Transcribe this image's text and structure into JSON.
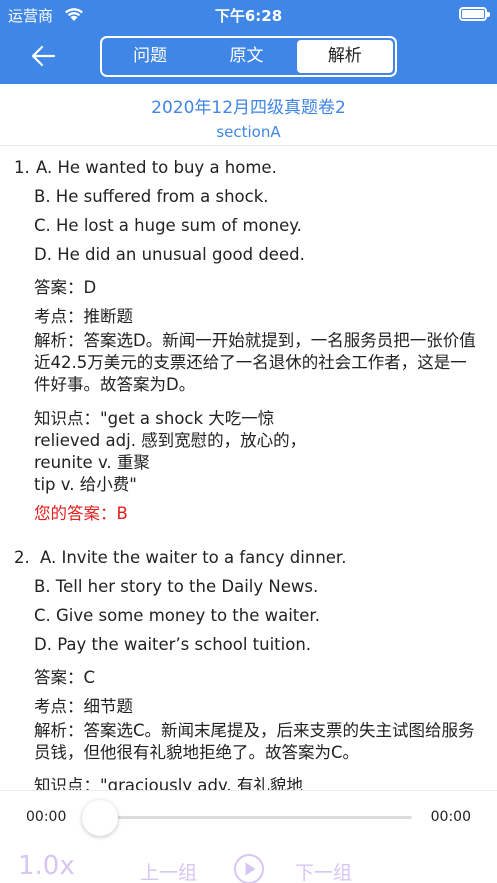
{
  "status_bar": {
    "carrier": "运营商",
    "time": "下午6:28"
  },
  "header": {
    "tabs": [
      "问题",
      "原文",
      "解析"
    ],
    "active_tab": "解析"
  },
  "title_block": {
    "title": "2020年12月四级真题卷2",
    "section": "sectionA"
  },
  "questions": [
    {
      "number": "1.",
      "options": [
        "A. He wanted to buy a home.",
        "B. He suffered from a shock.",
        "C. He lost a huge sum of money.",
        "D. He did an unusual good deed."
      ],
      "answer": "答案：D",
      "point": "考点：推断题",
      "analysis": "解析：答案选D。新闻一开始就提到，一名服务员把一张价值近42.5万美元的支票还给了一名退休的社会工作者，这是一件好事。故答案为D。",
      "knowledge": [
        "知识点：\"get a shock 大吃一惊",
        "relieved adj. 感到宽慰的，放心的，",
        "reunite v. 重聚",
        "tip v. 给小费\""
      ],
      "your_answer": "您的答案：B"
    },
    {
      "number": "2.",
      "options": [
        "A. Invite the waiter to a fancy dinner.",
        "B. Tell her story to the Daily News.",
        "C. Give some money to the waiter.",
        "D. Pay the waiter’s school tuition."
      ],
      "answer": "答案：C",
      "point": "考点：细节题",
      "analysis": "解析：答案选C。新闻末尾提及，后来支票的失主试图给服务员钱，但他很有礼貌地拒绝了。故答案为C。",
      "knowledge": [
        "知识点：\"graciously adv. 有礼貌地"
      ]
    }
  ],
  "player": {
    "current_time": "00:00",
    "total_time": "00:00",
    "progress": 0,
    "speed": "1.0x",
    "prev_label": "上一组",
    "next_label": "下一组"
  },
  "colors": {
    "header_bg": "#3f86e6",
    "accent": "#3f86e6",
    "your_answer_red": "#e02020",
    "player_controls": "#d6c6f2"
  }
}
